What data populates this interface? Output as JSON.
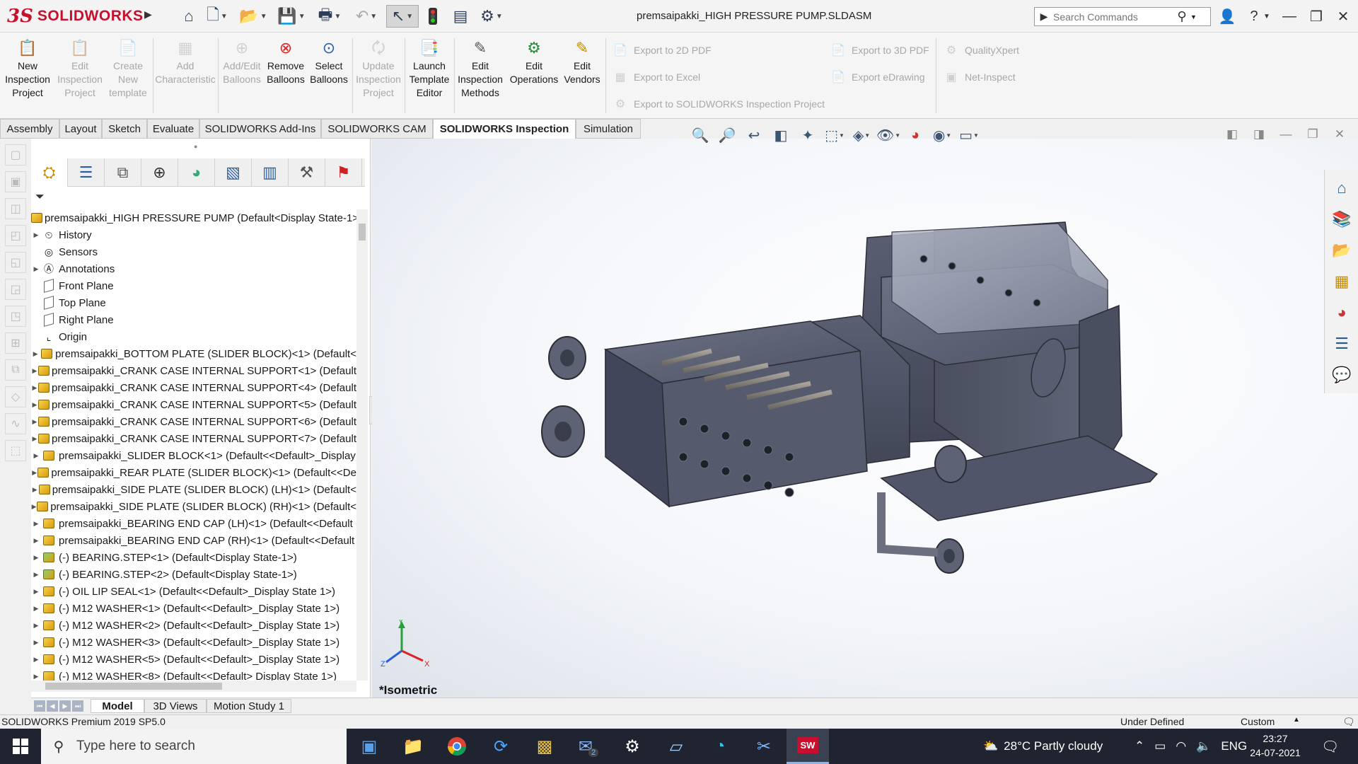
{
  "app": {
    "logo_ds": "3S",
    "logo_name": "SOLIDWORKS",
    "doc_title": "premsaipakki_HIGH PRESSURE PUMP.SLDASM"
  },
  "search": {
    "placeholder": "Search Commands"
  },
  "command_manager": {
    "buttons": [
      {
        "label": "New Inspection Project",
        "lines": [
          "New",
          "Inspection",
          "Project"
        ],
        "enabled": true
      },
      {
        "label": "Edit Inspection Project",
        "lines": [
          "Edit",
          "Inspection",
          "Project"
        ],
        "enabled": false
      },
      {
        "label": "Create New template",
        "lines": [
          "Create",
          "New",
          "template"
        ],
        "enabled": false
      },
      {
        "label": "Add Characteristic",
        "lines": [
          "Add",
          "Characteristic"
        ],
        "enabled": false
      },
      {
        "label": "Add/Edit Balloons",
        "lines": [
          "Add/Edit",
          "Balloons"
        ],
        "enabled": false
      },
      {
        "label": "Remove Balloons",
        "lines": [
          "Remove",
          "Balloons"
        ],
        "enabled": true
      },
      {
        "label": "Select Balloons",
        "lines": [
          "Select",
          "Balloons"
        ],
        "enabled": true
      },
      {
        "label": "Update Inspection Project",
        "lines": [
          "Update",
          "Inspection",
          "Project"
        ],
        "enabled": false
      },
      {
        "label": "Launch Template Editor",
        "lines": [
          "Launch",
          "Template",
          "Editor"
        ],
        "enabled": true
      },
      {
        "label": "Edit Inspection Methods",
        "lines": [
          "Edit",
          "Inspection",
          "Methods"
        ],
        "enabled": true
      },
      {
        "label": "Edit Operations",
        "lines": [
          "Edit",
          "Operations"
        ],
        "enabled": true
      },
      {
        "label": "Edit Vendors",
        "lines": [
          "Edit",
          "Vendors"
        ],
        "enabled": true
      }
    ],
    "export": {
      "pdf2d": "Export to 2D PDF",
      "excel": "Export to Excel",
      "sw_inspection": "Export to SOLIDWORKS Inspection Project",
      "pdf3d": "Export to 3D PDF",
      "edrawing": "Export eDrawing",
      "qualityxpert": "QualityXpert",
      "netinspect": "Net-Inspect"
    }
  },
  "tabs": [
    "Assembly",
    "Layout",
    "Sketch",
    "Evaluate",
    "SOLIDWORKS Add-Ins",
    "SOLIDWORKS CAM",
    "SOLIDWORKS Inspection",
    "Simulation"
  ],
  "active_tab": "SOLIDWORKS Inspection",
  "tree": {
    "root": "premsaipakki_HIGH PRESSURE PUMP  (Default<Display State-1>)",
    "items": [
      {
        "label": "History",
        "icon": "history",
        "expand": true
      },
      {
        "label": "Sensors",
        "icon": "sensor",
        "expand": false
      },
      {
        "label": "Annotations",
        "icon": "annotation",
        "expand": true
      },
      {
        "label": "Front Plane",
        "icon": "plane",
        "expand": false
      },
      {
        "label": "Top Plane",
        "icon": "plane",
        "expand": false
      },
      {
        "label": "Right Plane",
        "icon": "plane",
        "expand": false
      },
      {
        "label": "Origin",
        "icon": "origin",
        "expand": false
      },
      {
        "label": "premsaipakki_BOTTOM PLATE (SLIDER BLOCK)<1> (Default<",
        "icon": "part",
        "expand": true
      },
      {
        "label": "premsaipakki_CRANK CASE INTERNAL SUPPORT<1> (Default",
        "icon": "part",
        "expand": true
      },
      {
        "label": "premsaipakki_CRANK CASE INTERNAL SUPPORT<4> (Default",
        "icon": "part",
        "expand": true
      },
      {
        "label": "premsaipakki_CRANK CASE INTERNAL SUPPORT<5> (Default",
        "icon": "part",
        "expand": true
      },
      {
        "label": "premsaipakki_CRANK CASE INTERNAL SUPPORT<6> (Default",
        "icon": "part",
        "expand": true
      },
      {
        "label": "premsaipakki_CRANK CASE INTERNAL SUPPORT<7> (Default",
        "icon": "part",
        "expand": true
      },
      {
        "label": "premsaipakki_SLIDER BLOCK<1> (Default<<Default>_Display",
        "icon": "part",
        "expand": true
      },
      {
        "label": "premsaipakki_REAR PLATE (SLIDER BLOCK)<1> (Default<<De",
        "icon": "part",
        "expand": true
      },
      {
        "label": "premsaipakki_SIDE PLATE (SLIDER BLOCK) (LH)<1> (Default<",
        "icon": "part",
        "expand": true
      },
      {
        "label": "premsaipakki_SIDE PLATE (SLIDER BLOCK) (RH)<1> (Default<",
        "icon": "part",
        "expand": true
      },
      {
        "label": "premsaipakki_BEARING END CAP (LH)<1> (Default<<Default",
        "icon": "part",
        "expand": true
      },
      {
        "label": "premsaipakki_BEARING END CAP (RH)<1> (Default<<Default",
        "icon": "part",
        "expand": true
      },
      {
        "label": "(-) BEARING.STEP<1> (Default<Display State-1>)",
        "icon": "part-green",
        "expand": true
      },
      {
        "label": "(-) BEARING.STEP<2> (Default<Display State-1>)",
        "icon": "part-green",
        "expand": true
      },
      {
        "label": "(-) OIL LIP SEAL<1> (Default<<Default>_Display State 1>)",
        "icon": "part",
        "expand": true
      },
      {
        "label": "(-) M12 WASHER<1> (Default<<Default>_Display State 1>)",
        "icon": "part",
        "expand": true
      },
      {
        "label": "(-) M12 WASHER<2> (Default<<Default>_Display State 1>)",
        "icon": "part",
        "expand": true
      },
      {
        "label": "(-) M12 WASHER<3> (Default<<Default>_Display State 1>)",
        "icon": "part",
        "expand": true
      },
      {
        "label": "(-) M12 WASHER<5> (Default<<Default>_Display State 1>)",
        "icon": "part",
        "expand": true
      },
      {
        "label": "(-) M12 WASHER<8> (Default<<Default> Display State 1>)",
        "icon": "part",
        "expand": true
      }
    ]
  },
  "viewport": {
    "view_label": "*Isometric",
    "axes": {
      "x": "X",
      "y": "Y",
      "z": "Z"
    }
  },
  "model_tabs": [
    "Model",
    "3D Views",
    "Motion Study 1"
  ],
  "status": {
    "version": "SOLIDWORKS Premium 2019 SP5.0",
    "state": "Under Defined",
    "units": "Custom"
  },
  "taskbar": {
    "search_placeholder": "Type here to search",
    "weather": "28°C  Partly cloudy",
    "lang": "ENG",
    "time": "23:27",
    "date": "24-07-2021",
    "mail_badge": "2",
    "sw_label": "SW"
  }
}
